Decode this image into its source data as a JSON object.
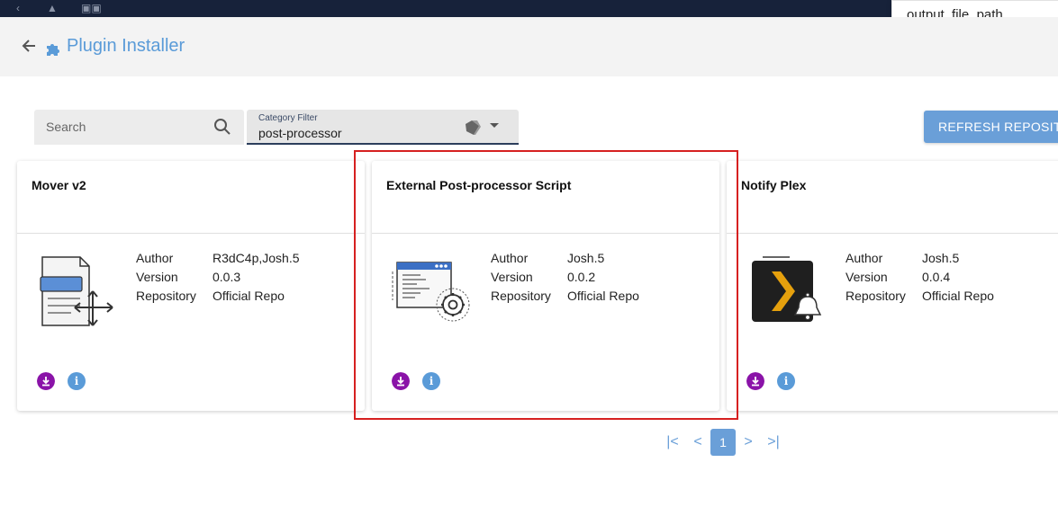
{
  "tooltip": {
    "text": "output_file_path"
  },
  "header": {
    "title": "Plugin Installer"
  },
  "search": {
    "placeholder": "Search"
  },
  "category_filter": {
    "caption": "Category Filter",
    "value": "post-processor"
  },
  "refresh_button": {
    "label": "REFRESH REPOSITORIES"
  },
  "meta_labels": {
    "author": "Author",
    "version": "Version",
    "repository": "Repository"
  },
  "cards": [
    {
      "title": "Mover v2",
      "author": "R3dC4p,Josh.5",
      "version": "0.0.3",
      "repository": "Official Repo",
      "icon": "mover-document-icon"
    },
    {
      "title": "External Post-processor Script",
      "author": "Josh.5",
      "version": "0.0.2",
      "repository": "Official Repo",
      "icon": "script-window-gear-icon"
    },
    {
      "title": "Notify Plex",
      "author": "Josh.5",
      "version": "0.0.4",
      "repository": "Official Repo",
      "icon": "plex-bell-icon"
    }
  ],
  "pagination": {
    "current_page": "1",
    "first": "|<",
    "prev": "<",
    "next": ">",
    "last": ">|"
  },
  "colors": {
    "accent": "#5a9bd8",
    "download": "#8a13a8",
    "topbar": "#17223a",
    "highlight": "#d62020"
  }
}
